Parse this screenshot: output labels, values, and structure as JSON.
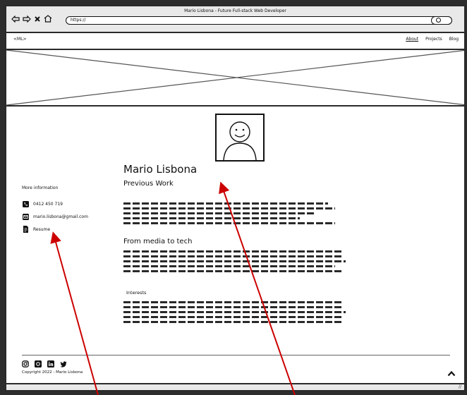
{
  "window": {
    "title": "Mario Lisbona - Future Full-stack Web Developer",
    "url": "https://"
  },
  "topbar": {
    "logo": "<ML>",
    "nav": [
      {
        "label": "About",
        "active": true
      },
      {
        "label": "Projects",
        "active": false
      },
      {
        "label": "Blog",
        "active": false
      }
    ]
  },
  "profile": {
    "name": "Mario Lisbona"
  },
  "sections": {
    "previous_work": "Previous Work",
    "media_to_tech": "From media to tech",
    "interests": "Interests"
  },
  "sidebar": {
    "title": "More information",
    "phone": "0412 450 719",
    "email": "mario.lisbona@gmail.com",
    "resume": "Resume"
  },
  "footer": {
    "copyright": "Copyright 2022 - Mario Lisbona",
    "icons": [
      "instagram-icon",
      "github-icon",
      "linkedin-icon",
      "twitter-icon"
    ]
  },
  "colors": {
    "background": "#2d2d2d",
    "annotation_arrow": "#cc0000"
  }
}
